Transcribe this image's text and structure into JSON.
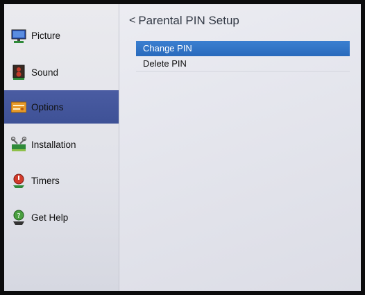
{
  "sidebar": {
    "items": [
      {
        "label": "Picture",
        "icon": "monitor-icon"
      },
      {
        "label": "Sound",
        "icon": "speaker-icon"
      },
      {
        "label": "Options",
        "icon": "options-panel-icon",
        "active": true
      },
      {
        "label": "Installation",
        "icon": "tools-icon"
      },
      {
        "label": "Timers",
        "icon": "timer-icon"
      },
      {
        "label": "Get Help",
        "icon": "help-icon"
      }
    ]
  },
  "main": {
    "title": "Parental PIN Setup",
    "back_glyph": "<",
    "menu": [
      {
        "label": "Change PIN",
        "selected": true
      },
      {
        "label": "Delete PIN",
        "selected": false
      }
    ]
  },
  "colors": {
    "active_sidebar": "#3e5196",
    "selected_menu": "#2f72c6"
  }
}
